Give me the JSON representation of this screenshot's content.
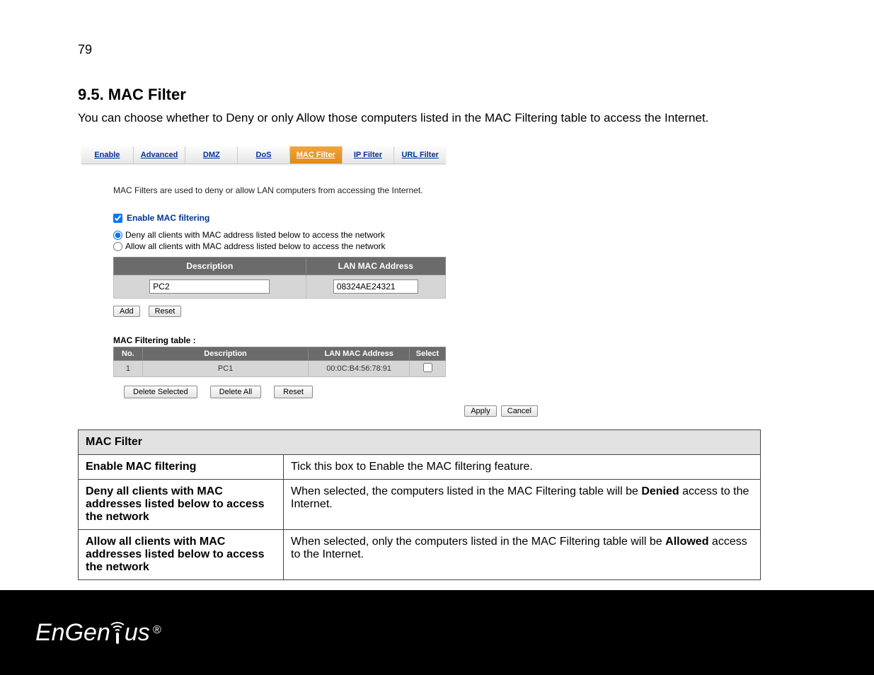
{
  "page_number": "79",
  "section_title": "9.5. MAC Filter",
  "intro": "You can choose whether to Deny or only Allow those computers listed in the MAC Filtering table to access the Internet.",
  "tabs": {
    "enable": "Enable",
    "advanced": "Advanced",
    "dmz": "DMZ",
    "dos": "DoS",
    "mac_filter": "MAC Filter",
    "ip_filter": "IP Filter",
    "url_filter": "URL Filter"
  },
  "ui_desc": "MAC Filters are used to deny or allow LAN computers from accessing the Internet.",
  "enable_label": "Enable MAC filtering",
  "radio_deny": "Deny all clients with MAC address listed below to access the network",
  "radio_allow": "Allow all clients with MAC address listed below to access the network",
  "input_headers": {
    "desc": "Description",
    "mac": "LAN MAC Address"
  },
  "input_values": {
    "desc": "PC2",
    "mac": "08324AE24321"
  },
  "buttons": {
    "add": "Add",
    "reset": "Reset",
    "delete_selected": "Delete Selected",
    "delete_all": "Delete All",
    "reset2": "Reset",
    "apply": "Apply",
    "cancel": "Cancel"
  },
  "filter_table_title": "MAC Filtering table :",
  "filter_headers": {
    "no": "No.",
    "desc": "Description",
    "mac": "LAN MAC Address",
    "select": "Select"
  },
  "filter_row": {
    "no": "1",
    "desc": "PC1",
    "mac": "00:0C:B4:56:78:91"
  },
  "explain": {
    "title": "MAC Filter",
    "r1_label": "Enable MAC filtering",
    "r1_desc": "Tick this box to Enable the MAC filtering feature.",
    "r2_label": "Deny all clients with MAC addresses listed below to access the network",
    "r2_desc_a": "When selected, the computers listed in the MAC Filtering table will be ",
    "r2_desc_b": "Denied",
    "r2_desc_c": " access to the Internet.",
    "r3_label": "Allow all clients with MAC addresses listed below to access the network",
    "r3_desc_a": "When selected, only the computers listed in the MAC Filtering table will be ",
    "r3_desc_b": "Allowed",
    "r3_desc_c": " access to the Internet."
  },
  "logo_text": {
    "a": "EnGen",
    "b": "us",
    "reg": "®"
  }
}
